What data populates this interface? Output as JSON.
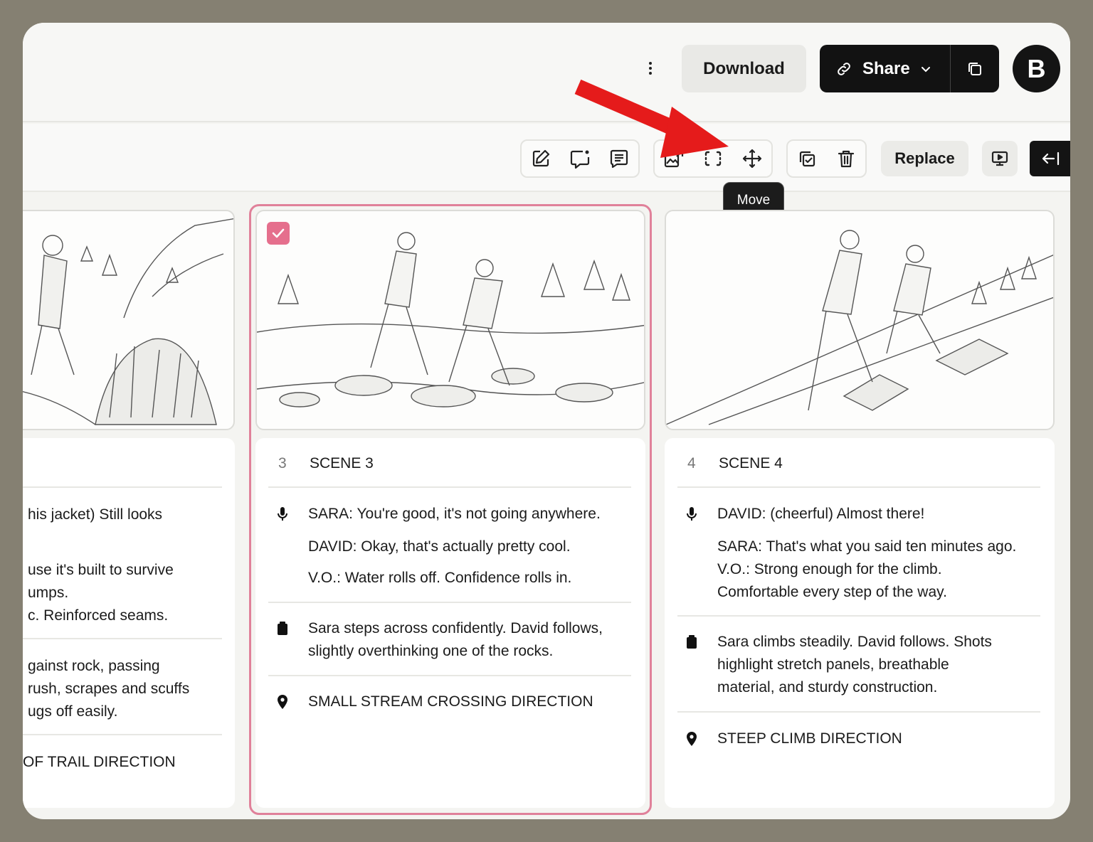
{
  "header": {
    "download_label": "Download",
    "share_label": "Share",
    "avatar_initial": "B"
  },
  "toolbar": {
    "replace_label": "Replace",
    "tooltip": "Move",
    "icons": [
      "edit-icon",
      "comment-add-icon",
      "notes-icon",
      "replace-image-icon",
      "crop-icon",
      "move-icon",
      "duplicate-icon",
      "trash-icon",
      "present-icon",
      "collapse-panel-icon"
    ]
  },
  "accent_colors": {
    "selection": "#e0819a",
    "checkbox": "#e56f8d",
    "annotation_arrow": "#e51b1b"
  },
  "scenes": [
    {
      "dialogue": [
        "his jacket) Still looks",
        "use it's built to survive",
        "umps.",
        "c. Reinforced seams."
      ],
      "action": [
        "gainst rock, passing",
        "rush, scrapes and scuffs",
        "ugs off easily."
      ],
      "location": "OF TRAIL DIRECTION"
    },
    {
      "number": "3",
      "title": "SCENE 3",
      "selected": true,
      "dialogue": [
        "SARA: You're good, it's not going anywhere.",
        "DAVID: Okay, that's actually pretty cool.",
        "V.O.: Water rolls off. Confidence rolls in."
      ],
      "action": [
        "Sara steps across confidently. David follows,",
        "slightly overthinking one of the rocks."
      ],
      "location": "SMALL STREAM CROSSING DIRECTION"
    },
    {
      "number": "4",
      "title": "SCENE 4",
      "dialogue": [
        "DAVID: (cheerful) Almost there!",
        "SARA: That's what you said ten minutes ago.",
        "V.O.: Strong enough for the climb.",
        "Comfortable every step of the way."
      ],
      "action": [
        "Sara climbs steadily. David follows. Shots",
        "highlight stretch panels, breathable",
        "material, and sturdy construction."
      ],
      "location": "STEEP CLIMB DIRECTION"
    }
  ]
}
